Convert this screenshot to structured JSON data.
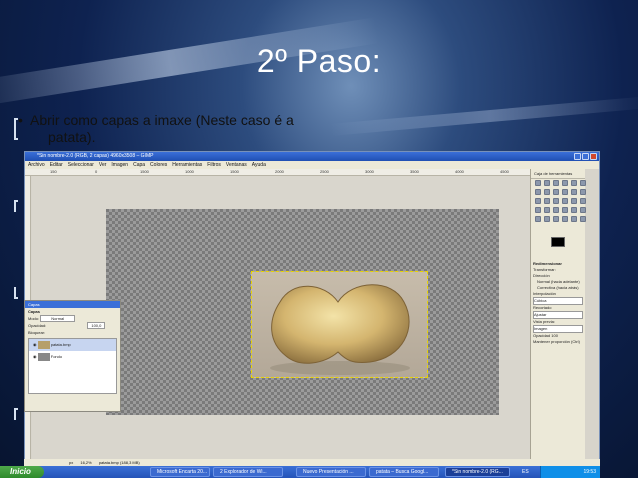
{
  "slide": {
    "title": "2º Paso:",
    "bullet_line1": "Abrir como capas a imaxe (Neste caso é a",
    "bullet_line2": "patata)."
  },
  "gimp": {
    "window_title": "*Sin nombre-2.0 (RGB, 2 capas) 4960x3508 – GIMP",
    "menu": [
      "Archivo",
      "Editar",
      "Seleccionar",
      "Ver",
      "Imagen",
      "Capa",
      "Colores",
      "Herramientas",
      "Filtros",
      "Ventanas",
      "Ayuda"
    ],
    "ruler_ticks": [
      "150",
      "0",
      "1500",
      "1000",
      "1500",
      "2000",
      "2500",
      "3000",
      "3500",
      "4000",
      "4500"
    ],
    "toolbox_title": "Caja de herramientas",
    "tool_options_title": "Redimensionar",
    "tool_options": {
      "transformar_label": "Transformar:",
      "direccion_label": "Dirección",
      "direccion_options": [
        "Normal (hacia adelante)",
        "Correctiva (hacia atrás)"
      ],
      "interpolacion_label": "Interpolación",
      "interpolacion_value": "Cúbica",
      "recortado_label": "Recortado",
      "recortado_value": "Ajustar",
      "vista_previa_label": "Vista previa:",
      "vista_previa_value": "Imagen",
      "opacidad_label": "Opacidad",
      "opacidad_value": "100",
      "mantener_label": "Mantener proporción (Ctrl)"
    },
    "layers_dialog": {
      "title": "Capas",
      "section": "Capas",
      "modo_label": "Modo:",
      "modo_value": "Normal",
      "opacidad_label": "Opacidad:",
      "opacidad_value": "100,0",
      "bloquear_label": "Bloquear:",
      "layers": [
        "patata.bmp",
        "Fondo"
      ]
    },
    "status": {
      "unit": "px",
      "zoom": "16,2%",
      "layer_info": "patata.bmp (188,3 MB)"
    }
  },
  "taskbar": {
    "start_label": "Inicio",
    "tasks": [
      "Microsoft Encarta 20...",
      "2 Explorador de Wi...",
      "Nuevo Presentación ...",
      "patata – Busca Googl...",
      "*Sin nombre-2.0 (RG..."
    ],
    "lang": "ES",
    "clock": "19:53"
  },
  "colors": {
    "accent": "#2453b8",
    "slide_title": "#ffffff"
  }
}
